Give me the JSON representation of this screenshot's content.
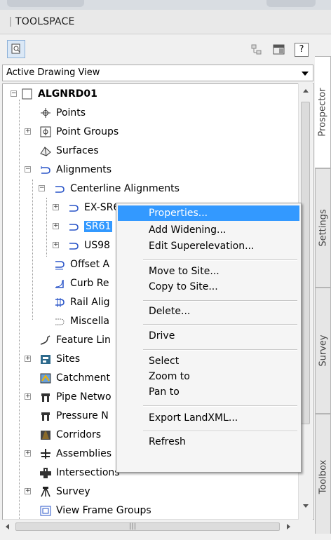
{
  "palette": {
    "accent": "#3399ff",
    "panel": "#f0f0f0"
  },
  "panel": {
    "title": "TOOLSPACE"
  },
  "view_select": {
    "value": "Active Drawing View"
  },
  "side_tabs": [
    "Prospector",
    "Settings",
    "Survey",
    "Toolbox"
  ],
  "tree": {
    "root": "ALGNRD01",
    "items": [
      "Points",
      "Point Groups",
      "Surfaces",
      "Alignments",
      "Centerline Alignments",
      "EX-SR61",
      "SR61",
      "US98",
      "Offset A",
      "Curb Re",
      "Rail Alig",
      "Miscella",
      "Feature Lin",
      "Sites",
      "Catchment",
      "Pipe Netwo",
      "Pressure N",
      "Corridors",
      "Assemblies",
      "Intersections",
      "Survey",
      "View Frame Groups"
    ]
  },
  "context_menu": {
    "items": [
      "Properties...",
      "Add Widening...",
      "Edit Superelevation...",
      "Move to Site...",
      "Copy to Site...",
      "Delete...",
      "Drive",
      "Select",
      "Zoom to",
      "Pan to",
      "Export LandXML...",
      "Refresh"
    ]
  },
  "icons": [
    "pan-icon",
    "item-view-icon",
    "panel-icon",
    "help-icon",
    "point-icon",
    "point-group-icon",
    "surface-icon",
    "alignment-icon",
    "site-icon",
    "pipe-icon",
    "corridor-icon",
    "assembly-icon",
    "intersection-icon",
    "survey-icon",
    "view-frame-icon"
  ]
}
